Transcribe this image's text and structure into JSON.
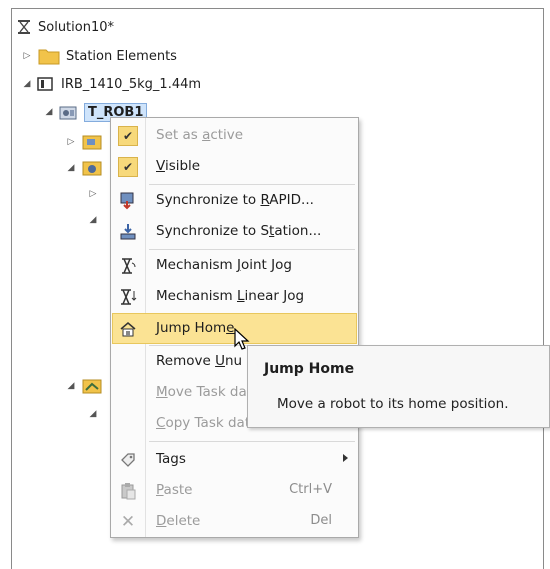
{
  "tree": {
    "root": "Solution10*",
    "station_elements": "Station Elements",
    "robot": "IRB_1410_5kg_1.44m",
    "task": "T_ROB1"
  },
  "menu": {
    "set_active": {
      "pre": "Set as ",
      "u": "a",
      "post": "ctive"
    },
    "visible": {
      "pre": "",
      "u": "V",
      "post": "isible"
    },
    "sync_rapid": {
      "pre": "Synchronize to ",
      "u": "R",
      "post": "APID..."
    },
    "sync_station": {
      "pre": "Synchronize to S",
      "u": "t",
      "post": "ation..."
    },
    "joint_jog": {
      "pre": "Mechanism ",
      "u": "J",
      "post": "oint Jog"
    },
    "linear_jog": {
      "pre": "Mechanism ",
      "u": "L",
      "post": "inear Jog"
    },
    "jump_home": {
      "pre": "Jump Hom",
      "u": "e",
      "post": ""
    },
    "remove": {
      "pre": "Remove ",
      "u": "U",
      "post": "nu"
    },
    "move_task": {
      "pre": "",
      "u": "M",
      "post": "ove Task da"
    },
    "copy_task": {
      "pre": "",
      "u": "C",
      "post": "opy Task data to"
    },
    "tags": {
      "pre": "Tags",
      "u": "",
      "post": ""
    },
    "paste": {
      "pre": "",
      "u": "P",
      "post": "aste",
      "shortcut": "Ctrl+V"
    },
    "delete": {
      "pre": "",
      "u": "D",
      "post": "elete",
      "shortcut": "Del"
    }
  },
  "tooltip": {
    "title": "Jump Home",
    "body": "Move a robot to its home position."
  }
}
